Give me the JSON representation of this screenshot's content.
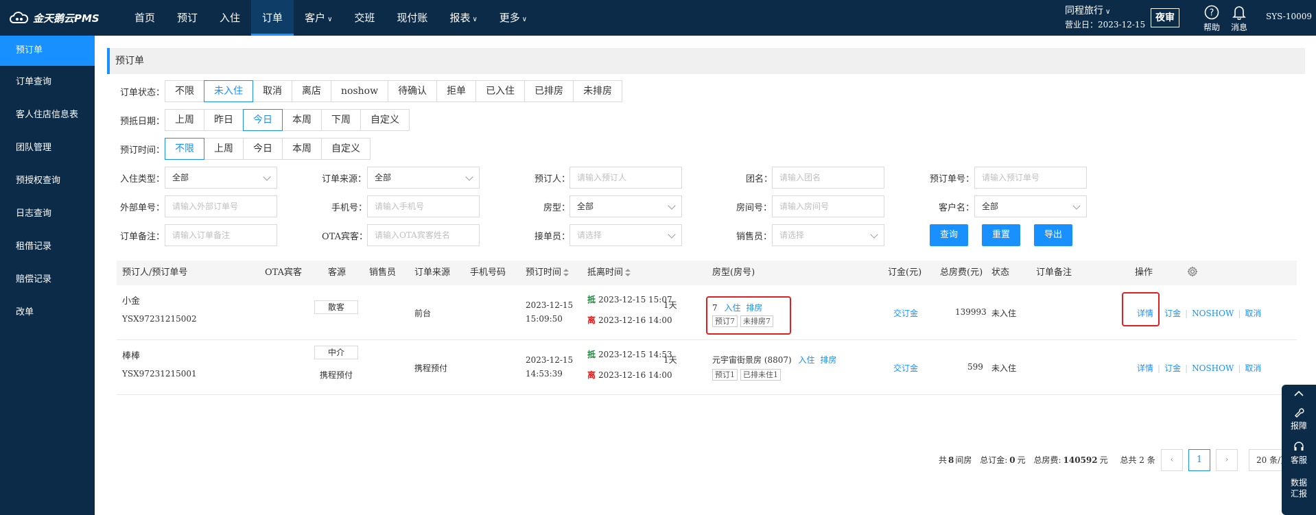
{
  "header": {
    "logo_text": "金天鹅云PMS",
    "nav": [
      {
        "label": "首页",
        "dropdown": false
      },
      {
        "label": "预订",
        "dropdown": false
      },
      {
        "label": "入住",
        "dropdown": false
      },
      {
        "label": "订单",
        "dropdown": false,
        "active": true
      },
      {
        "label": "客户",
        "dropdown": true
      },
      {
        "label": "交班",
        "dropdown": false
      },
      {
        "label": "现付账",
        "dropdown": false
      },
      {
        "label": "报表",
        "dropdown": true
      },
      {
        "label": "更多",
        "dropdown": true
      }
    ],
    "hotel_name": "同程旅行",
    "business_date_label": "营业日：2023-12-15",
    "night_audit": "夜审",
    "help": "帮助",
    "messages": "消息",
    "user": "SYS-10009"
  },
  "sidebar": {
    "items": [
      "预订单",
      "订单查询",
      "客人住店信息表",
      "团队管理",
      "预授权查询",
      "日志查询",
      "租借记录",
      "赔偿记录",
      "改单"
    ]
  },
  "page_title": "预订单",
  "filters": {
    "order_status": {
      "label": "订单状态：",
      "options": [
        "不限",
        "未入住",
        "取消",
        "离店",
        "noshow",
        "待确认",
        "拒单",
        "已入住",
        "已排房",
        "未排房"
      ],
      "selected": "未入住"
    },
    "arrival_date": {
      "label": "预抵日期：",
      "options": [
        "上周",
        "昨日",
        "今日",
        "本周",
        "下周",
        "自定义"
      ],
      "selected": "今日"
    },
    "booking_time": {
      "label": "预订时间：",
      "options": [
        "不限",
        "上周",
        "今日",
        "本周",
        "自定义"
      ],
      "selected": "不限"
    },
    "checkin_type": {
      "label": "入住类型：",
      "value": "全部"
    },
    "order_source": {
      "label": "订单来源：",
      "value": "全部"
    },
    "booker": {
      "label": "预订人：",
      "placeholder": "请输入预订人"
    },
    "group_name": {
      "label": "团名：",
      "placeholder": "请输入团名"
    },
    "booking_no": {
      "label": "预订单号：",
      "placeholder": "请输入预订单号"
    },
    "external_no": {
      "label": "外部单号：",
      "placeholder": "请输入外部订单号"
    },
    "phone": {
      "label": "手机号：",
      "placeholder": "请输入手机号"
    },
    "room_type": {
      "label": "房型：",
      "value": "全部"
    },
    "room_no": {
      "label": "房间号：",
      "placeholder": "请输入房间号"
    },
    "customer": {
      "label": "客户名：",
      "value": "全部"
    },
    "remark": {
      "label": "订单备注：",
      "placeholder": "请输入订单备注"
    },
    "ota_guest": {
      "label": "OTA宾客：",
      "placeholder": "请输入OTA宾客姓名"
    },
    "receiver": {
      "label": "接单员：",
      "placeholder": "请选择"
    },
    "salesperson": {
      "label": "销售员：",
      "placeholder": "请选择"
    },
    "buttons": {
      "search": "查询",
      "reset": "重置",
      "export": "导出"
    }
  },
  "table": {
    "columns": [
      "预订人/预订单号",
      "OTA宾客",
      "客源",
      "销售员",
      "订单来源",
      "手机号码",
      "预订时间",
      "抵离时间",
      "房型(房号)",
      "订金(元)",
      "总房费(元)",
      "状态",
      "订单备注",
      "操作"
    ],
    "rows": [
      {
        "booker": "小金",
        "order_no": "YSX97231215002",
        "ota_guest": "",
        "source_tag": "散客",
        "source_sub": "",
        "salesperson": "",
        "order_source": "前台",
        "phone": "",
        "booking_date": "2023-12-15",
        "booking_clock": "15:09:50",
        "arrive_mark": "抵",
        "arrive": "2023-12-15 15:07",
        "leave_mark": "离",
        "leave": "2023-12-16 14:00",
        "nights": "1天",
        "room_prefix": "7",
        "room_checkin": "入住",
        "room_assign": "排房",
        "tag1": "预订7",
        "tag2": "未排房7",
        "deposit_link": "交订金",
        "total": "139993",
        "status": "未入住",
        "remark": "",
        "actions": [
          "详情",
          "订金",
          "NOSHOW",
          "取消"
        ]
      },
      {
        "booker": "棒棒",
        "order_no": "YSX97231215001",
        "ota_guest": "",
        "source_tag": "中介",
        "source_sub": "携程预付",
        "salesperson": "",
        "order_source": "携程预付",
        "phone": "",
        "booking_date": "2023-12-15",
        "booking_clock": "14:53:39",
        "arrive_mark": "抵",
        "arrive": "2023-12-15 14:53",
        "leave_mark": "离",
        "leave": "2023-12-16 14:00",
        "nights": "1天",
        "room_prefix": "元宇宙街景房 (8807)",
        "room_checkin": "入住",
        "room_assign": "排房",
        "tag1": "预订1",
        "tag2": "已排未住1",
        "deposit_link": "交订金",
        "total": "599",
        "status": "未入住",
        "remark": "",
        "actions": [
          "详情",
          "订金",
          "NOSHOW",
          "取消"
        ]
      }
    ]
  },
  "footer": {
    "rooms_prefix": "共",
    "rooms": "8",
    "rooms_suffix": "间房",
    "deposit_prefix": "总订金:",
    "deposit": "0",
    "deposit_suffix": "元",
    "fee_prefix": "总房费:",
    "fee": "140592",
    "fee_suffix": "元",
    "count": "总共 2 条",
    "page": "1",
    "page_size": "20 条/页"
  },
  "float_panel": [
    "报障",
    "客服",
    "数据汇报"
  ],
  "colors": {
    "primary": "#1890ff",
    "nav_bg": "#0b2b48",
    "highlight": "#e02020"
  }
}
